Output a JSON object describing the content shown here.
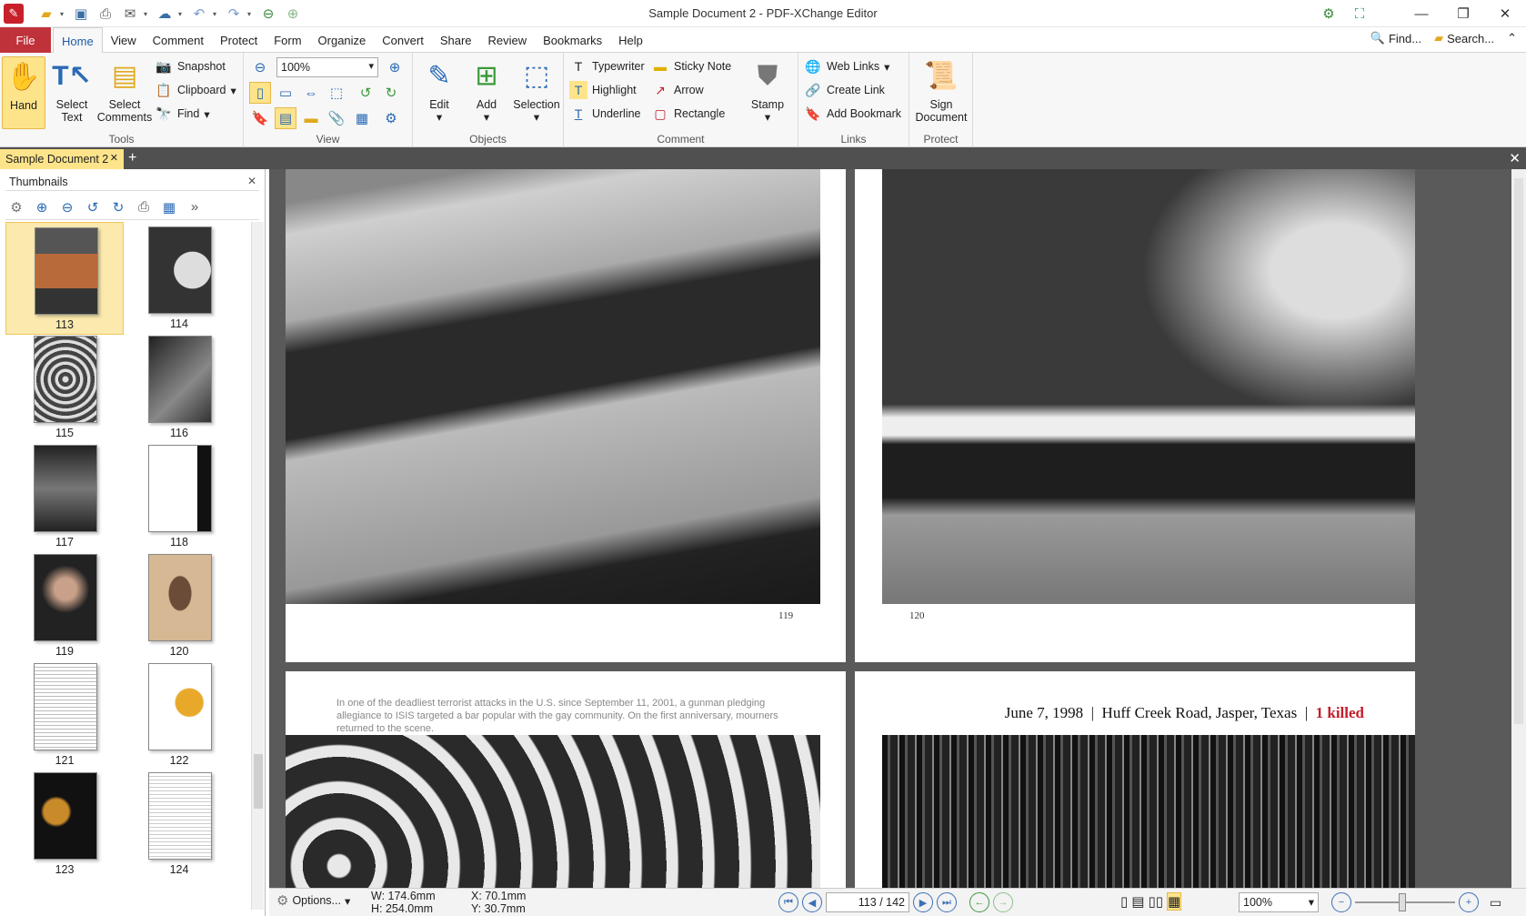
{
  "window": {
    "title": "Sample Document 2 - PDF-XChange Editor"
  },
  "menu": {
    "file": "File",
    "tabs": [
      "Home",
      "View",
      "Comment",
      "Protect",
      "Form",
      "Organize",
      "Convert",
      "Share",
      "Review",
      "Bookmarks",
      "Help"
    ],
    "active_tab": "Home",
    "find": "Find...",
    "search": "Search..."
  },
  "ribbon": {
    "tools": {
      "label": "Tools",
      "hand": "Hand",
      "select_text": [
        "Select",
        "Text"
      ],
      "select_comments": [
        "Select",
        "Comments"
      ],
      "snapshot": "Snapshot",
      "clipboard": "Clipboard",
      "find": "Find"
    },
    "view": {
      "label": "View",
      "zoom": "100%"
    },
    "objects": {
      "label": "Objects",
      "edit": "Edit",
      "add": "Add",
      "selection": "Selection"
    },
    "comment": {
      "label": "Comment",
      "typewriter": "Typewriter",
      "sticky_note": "Sticky Note",
      "highlight": "Highlight",
      "arrow": "Arrow",
      "underline": "Underline",
      "rectangle": "Rectangle",
      "stamp": "Stamp"
    },
    "links": {
      "label": "Links",
      "web_links": "Web Links",
      "create_link": "Create Link",
      "add_bookmark": "Add Bookmark"
    },
    "protect": {
      "label": "Protect",
      "sign_document": [
        "Sign",
        "Document"
      ]
    }
  },
  "doc_tab": {
    "name": "Sample Document 2"
  },
  "thumbnails": {
    "title": "Thumbnails",
    "pages": [
      "113",
      "114",
      "115",
      "116",
      "117",
      "118",
      "119",
      "120",
      "121",
      "122",
      "123",
      "124"
    ],
    "selected": "113"
  },
  "document": {
    "page_left_top_number": "119",
    "page_right_top_number": "120",
    "caption": "In one of the deadliest terrorist attacks in the U.S. since September 11, 2001, a gunman pledging allegiance to ISIS targeted a bar popular with the gay community. On the first anniversary, mourners returned to the scene.",
    "headline_date": "June 7, 1998",
    "headline_place": "Huff Creek Road, Jasper, Texas",
    "headline_killed": "1 killed"
  },
  "status": {
    "options": "Options...",
    "width": "W: 174.6mm",
    "height": "H: 254.0mm",
    "x": "X:   70.1mm",
    "y": "Y:   30.7mm",
    "current_page": "113",
    "total_pages": "142",
    "zoom": "100%"
  },
  "colors": {
    "accent": "#c0323a",
    "highlight": "#fde48a",
    "link_blue": "#1c5da6"
  }
}
